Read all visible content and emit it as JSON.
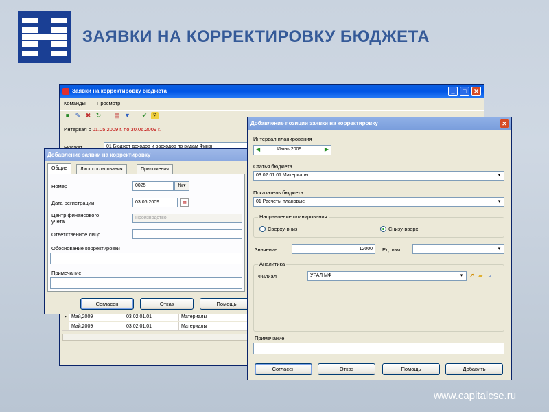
{
  "slide": {
    "title": "ЗАЯВКИ НА КОРРЕКТИРОВКУ БЮДЖЕТА",
    "website": "www.capitalcse.ru"
  },
  "main_window": {
    "title": "Заявки на корректировку бюджета",
    "menu": [
      "Команды",
      "Просмотр"
    ],
    "interval_prefix": "Интервал с ",
    "interval_value": "01.05.2009 г. по 30.06.2009 г.",
    "budget_label": "Бюджет",
    "budget_value": "01 Бюджет доходов и расходов по видам Финан",
    "rows": [
      {
        "period": "Май,2009",
        "code": "03.02.01.01",
        "name": "Материалы"
      },
      {
        "period": "Май,2009",
        "code": "03.02.01.01",
        "name": "Материалы"
      }
    ]
  },
  "add_request": {
    "title": "Добавление заявки на корректировку",
    "tabs": [
      "Общие",
      "Лист согласования",
      "Приложения"
    ],
    "number_label": "Номер",
    "number_value": "0025",
    "number_badge": "№",
    "reg_date_label": "Дата регистрации",
    "reg_date_value": "03.06.2009",
    "fin_center_label": "Центр финансового учета",
    "fin_center_value": "Производство",
    "responsible_label": "Ответственное лицо",
    "justification_label": "Обоснование корректировки",
    "note_label": "Примечание",
    "btn_ok": "Согласен",
    "btn_cancel": "Отказ",
    "btn_help": "Помощь"
  },
  "add_position": {
    "title": "Добавление позиции заявки на корректировку",
    "interval_label": "Интервал планирования",
    "interval_value": "Июнь,2009",
    "budget_item_label": "Статья бюджета",
    "budget_item_value": "03.02.01.01 Материалы",
    "indicator_label": "Показатель бюджета",
    "indicator_value": "01 Расчеты плановые",
    "direction_label": "Направление планирования",
    "direction_top_down": "Сверху-вниз",
    "direction_bottom_up": "Снизу-вверх",
    "direction_selected": "Снизу-вверх",
    "value_label": "Значение",
    "value_value": "12000",
    "unit_label": "Ед. изм.",
    "analytics_label": "Аналитика",
    "branch_label": "Филиал",
    "branch_value": "УРАЛ МФ",
    "note_label": "Примечание",
    "btn_ok": "Согласен",
    "btn_cancel": "Отказ",
    "btn_help": "Помощь",
    "btn_add": "Добавить"
  },
  "colors": {
    "title_text": "#355a98",
    "logo_bg": "#1a3f94",
    "xp_title_bar": "#0055e5",
    "dialog_bg": "#ece9d8",
    "interval_red": "#c00000"
  }
}
